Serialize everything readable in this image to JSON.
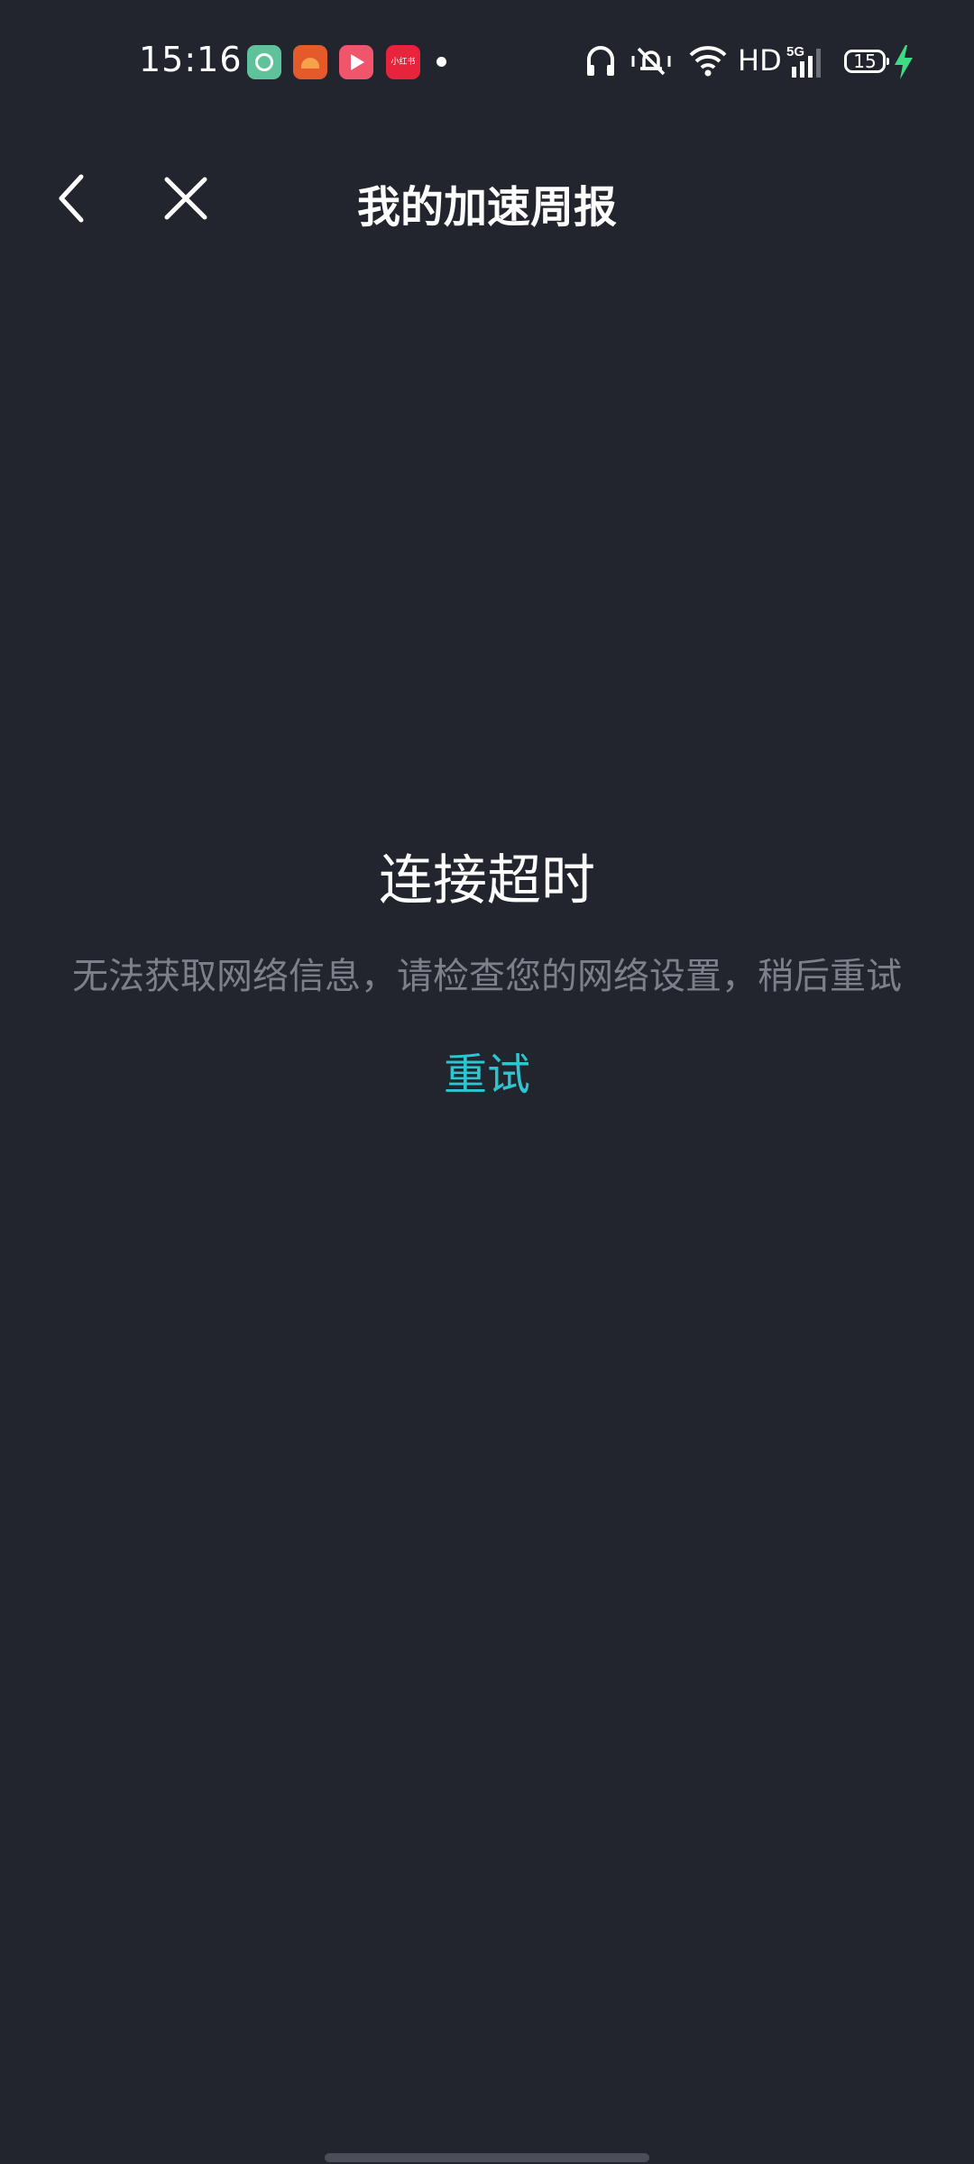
{
  "status_bar": {
    "time": "15:16",
    "app_icons": [
      "green-circle-app-icon",
      "orange-app-icon",
      "pink-play-app-icon",
      "red-app-icon"
    ],
    "red_app_label": "小红书",
    "network_label": "HD",
    "cell_label": "5G",
    "battery_level": "15",
    "charging_color": "#3ddc84"
  },
  "nav_bar": {
    "title": "我的加速周报",
    "back_icon": "chevron-left-icon",
    "close_icon": "close-icon"
  },
  "error": {
    "title": "连接超时",
    "message": "无法获取网络信息，请检查您的网络设置，稍后重试",
    "retry_label": "重试"
  },
  "colors": {
    "background": "#23252e",
    "accent": "#2ec4d0",
    "secondary_text": "#7d808b"
  }
}
